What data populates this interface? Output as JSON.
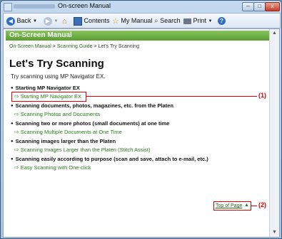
{
  "window": {
    "title": "On-screen Manual"
  },
  "window_controls": {
    "minimize": "–",
    "maximize": "□",
    "close": "x"
  },
  "toolbar": {
    "back": "Back",
    "contents": "Contents",
    "my_manual": "My Manual",
    "search": "Search",
    "print": "Print"
  },
  "banner": {
    "title": "On-Screen Manual"
  },
  "breadcrumb": {
    "items": [
      "On-Screen Manual",
      "Scanning Guide",
      "Let's Try Scanning"
    ],
    "separator": ">"
  },
  "page": {
    "title": "Let's Try Scanning",
    "intro": "Try scanning using MP Navigator EX.",
    "sections": [
      {
        "heading": "Starting MP Navigator EX",
        "link": "Starting MP Navigator EX"
      },
      {
        "heading": "Scanning documents, photos, magazines, etc. from the Platen",
        "link": "Scanning Photos and Documents"
      },
      {
        "heading": "Scanning two or more photos (small documents) at one time",
        "link": "Scanning Multiple Documents at One Time"
      },
      {
        "heading": "Scanning images larger than the Platen",
        "link": "Scanning Images Larger than the Platen (Stitch Assist)"
      },
      {
        "heading": "Scanning easily according to purpose (scan and save, attach to e-mail, etc.)",
        "link": "Easy Scanning with One-click"
      }
    ],
    "top_of_page": "Top of Page"
  },
  "callouts": {
    "one": "(1)",
    "two": "(2)"
  },
  "icons": {
    "back": "back-arrow-icon",
    "forward": "forward-arrow-icon",
    "home": "home-icon",
    "contents": "contents-book-icon",
    "my_manual": "star-icon",
    "search": "magnifier-icon",
    "print": "printer-icon",
    "help": "help-icon"
  },
  "colors": {
    "banner": "#6cb043",
    "link": "#2a7a1e",
    "highlight": "#e00000"
  }
}
